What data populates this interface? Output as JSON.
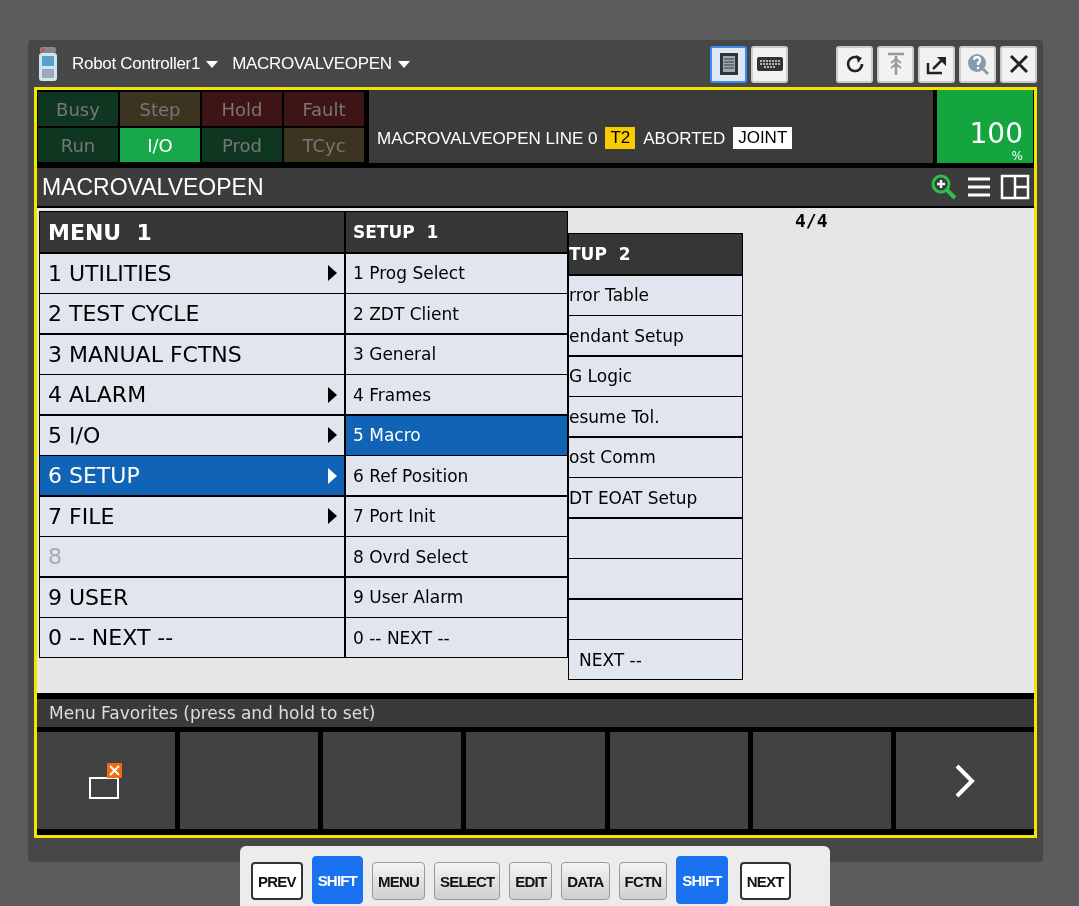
{
  "title_bar": {
    "controller": "Robot Controller1",
    "program": "MACROVALVEOPEN",
    "tools": [
      {
        "kind": "tablet",
        "selected": true
      },
      {
        "kind": "keyboard",
        "selected": false
      },
      {
        "kind": "refresh",
        "selected": false
      },
      {
        "kind": "hold",
        "selected": false
      },
      {
        "kind": "export",
        "selected": false
      },
      {
        "kind": "help",
        "selected": false
      },
      {
        "kind": "close",
        "selected": false
      }
    ]
  },
  "lamps": [
    {
      "label": "Busy",
      "on": false,
      "color": "#0f3620"
    },
    {
      "label": "Step",
      "on": false,
      "color": "#3a3420"
    },
    {
      "label": "Hold",
      "on": false,
      "color": "#3e1414"
    },
    {
      "label": "Fault",
      "on": false,
      "color": "#3e1414"
    },
    {
      "label": "Run",
      "on": false,
      "color": "#0f3620"
    },
    {
      "label": "I/O",
      "on": true,
      "color": "#19a849"
    },
    {
      "label": "Prod",
      "on": false,
      "color": "#0f3620"
    },
    {
      "label": "TCyc",
      "on": false,
      "color": "#3a3420"
    }
  ],
  "status": {
    "program_line": "MACROVALVEOPEN LINE 0",
    "mode": "T2",
    "state": "ABORTED",
    "coord": "JOINT"
  },
  "override": {
    "value": "100",
    "unit": "%"
  },
  "screen_title": "MACROVALVEOPEN",
  "page_counter": "4/4",
  "menu": {
    "title": "MENU  1",
    "items": [
      {
        "label": "1 UTILITIES",
        "submenu": true,
        "selected": false,
        "disabled": false
      },
      {
        "label": "2 TEST CYCLE",
        "submenu": false,
        "selected": false,
        "disabled": false
      },
      {
        "label": "3 MANUAL FCTNS",
        "submenu": false,
        "selected": false,
        "disabled": false
      },
      {
        "label": "4 ALARM",
        "submenu": true,
        "selected": false,
        "disabled": false
      },
      {
        "label": "5 I/O",
        "submenu": true,
        "selected": false,
        "disabled": false
      },
      {
        "label": "6 SETUP",
        "submenu": true,
        "selected": true,
        "disabled": false
      },
      {
        "label": "7 FILE",
        "submenu": true,
        "selected": false,
        "disabled": false
      },
      {
        "label": "8",
        "submenu": false,
        "selected": false,
        "disabled": true
      },
      {
        "label": "9 USER",
        "submenu": false,
        "selected": false,
        "disabled": false
      },
      {
        "label": "0 -- NEXT --",
        "submenu": false,
        "selected": false,
        "disabled": false
      }
    ]
  },
  "setup_menu": {
    "title": "SETUP  1",
    "items": [
      {
        "label": "1 Prog Select",
        "selected": false
      },
      {
        "label": "2 ZDT Client",
        "selected": false
      },
      {
        "label": "3 General",
        "selected": false
      },
      {
        "label": "4 Frames",
        "selected": false
      },
      {
        "label": "5 Macro",
        "selected": true
      },
      {
        "label": "6 Ref Position",
        "selected": false
      },
      {
        "label": "7 Port Init",
        "selected": false
      },
      {
        "label": "8 Ovrd Select",
        "selected": false
      },
      {
        "label": "9 User Alarm",
        "selected": false
      },
      {
        "label": "0 -- NEXT --",
        "selected": false
      }
    ]
  },
  "setup_menu_2": {
    "title": "TUP  2",
    "items": [
      {
        "kind": "item",
        "label": "rror Table"
      },
      {
        "kind": "item",
        "label": "endant Setup"
      },
      {
        "kind": "item",
        "label": "G Logic"
      },
      {
        "kind": "item",
        "label": "esume Tol."
      },
      {
        "kind": "item",
        "label": "ost Comm"
      },
      {
        "kind": "item",
        "label": "DT EOAT Setup"
      },
      {
        "kind": "blank"
      },
      {
        "kind": "blank"
      },
      {
        "kind": "blank"
      },
      {
        "kind": "item",
        "label": "NEXT --"
      }
    ]
  },
  "favorites_label": "Menu Favorites (press and hold to set)",
  "function_keys": [
    {
      "kind": "close-window"
    },
    {
      "kind": "empty"
    },
    {
      "kind": "empty"
    },
    {
      "kind": "empty"
    },
    {
      "kind": "empty"
    },
    {
      "kind": "empty"
    },
    {
      "kind": "next"
    }
  ],
  "keys": [
    {
      "label": "PREV",
      "kind": "nav"
    },
    {
      "label": "SHIFT",
      "kind": "shift"
    },
    {
      "label": "MENU",
      "kind": "key"
    },
    {
      "label": "SELECT",
      "kind": "key"
    },
    {
      "label": "EDIT",
      "kind": "key"
    },
    {
      "label": "DATA",
      "kind": "key"
    },
    {
      "label": "FCTN",
      "kind": "key"
    },
    {
      "label": "SHIFT",
      "kind": "shift"
    },
    {
      "label": "NEXT",
      "kind": "nav"
    }
  ]
}
